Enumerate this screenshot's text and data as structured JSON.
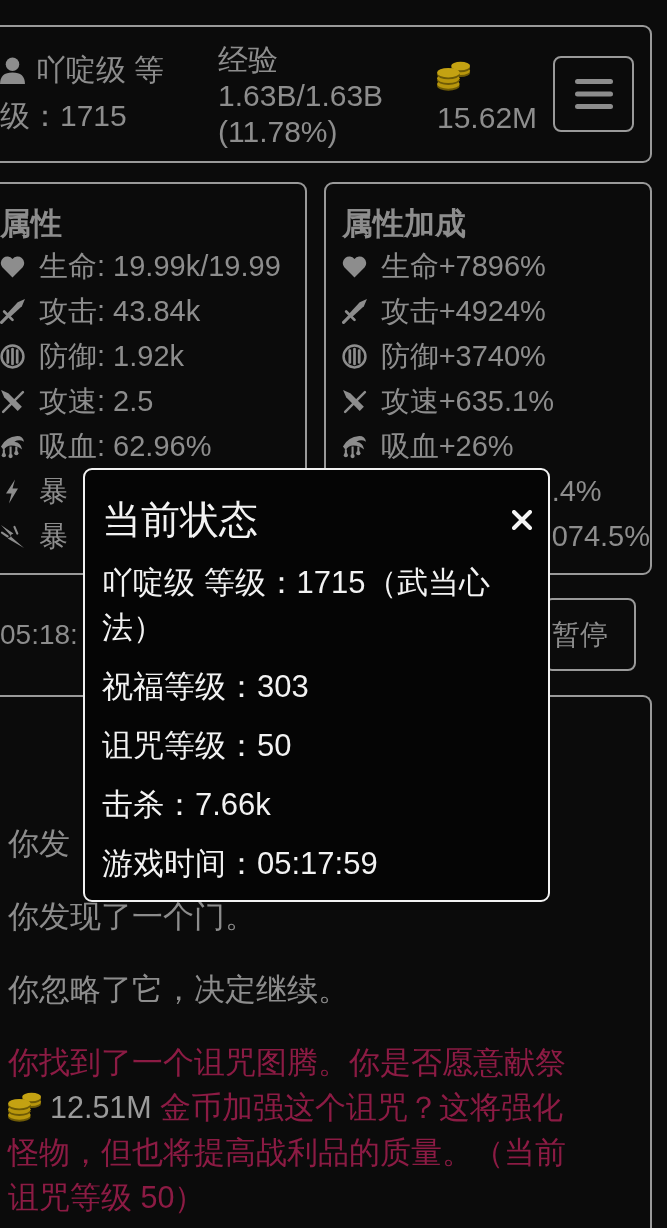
{
  "header": {
    "player": {
      "lines": [
        "吖啶级 等",
        "级：1715"
      ]
    },
    "experience": {
      "label": "经验",
      "value": "1.63B/1.63B",
      "percent": "(11.78%)"
    },
    "gold": "15.62M"
  },
  "panels": [
    {
      "title": "属性",
      "rows": [
        {
          "kind": "life",
          "text": "生命: 19.99k/19.99"
        },
        {
          "kind": "attack",
          "text": "攻击: 43.84k"
        },
        {
          "kind": "defense",
          "text": "防御: 1.92k"
        },
        {
          "kind": "speed",
          "text": "攻速: 2.5"
        },
        {
          "kind": "drain",
          "text": "吸血: 62.96%"
        },
        {
          "kind": "critrate",
          "text": "暴"
        },
        {
          "kind": "critdamage",
          "text": "暴"
        }
      ]
    },
    {
      "title": "属性加成",
      "rows": [
        {
          "kind": "life",
          "text": "生命+7896%"
        },
        {
          "kind": "attack",
          "text": "攻击+4924%"
        },
        {
          "kind": "defense",
          "text": "防御+3740%"
        },
        {
          "kind": "speed",
          "text": "攻速+635.1%"
        },
        {
          "kind": "drain",
          "text": "吸血+26%"
        },
        {
          "kind": "tail",
          "text": ".4%"
        },
        {
          "kind": "tail",
          "text": "074.5%"
        }
      ]
    }
  ],
  "timer": {
    "clock": "05:18:",
    "pause_button": "暂停"
  },
  "log": [
    {
      "kind": "plain",
      "text": "你发"
    },
    {
      "kind": "plain",
      "text": "你发现了一个门。"
    },
    {
      "kind": "plain",
      "text": "你忽略了它，决定继续。"
    },
    {
      "kind": "event",
      "segments": [
        {
          "kind": "text",
          "text": "你找到了一个诅咒图腾。你是否愿意献祭"
        },
        {
          "kind": "coin"
        },
        {
          "kind": "amount",
          "text": "12.51M"
        },
        {
          "kind": "text",
          "text": "金币加强这个诅咒？这将强化怪物，但也将提高战利品的质量。（当前诅咒等级 50）"
        }
      ]
    }
  ],
  "dialog": {
    "title": "当前状态",
    "lines": [
      "吖啶级 等级：1715（武当心法）",
      "祝福等级：303",
      "诅咒等级：50",
      "击杀：7.66k",
      "游戏时间：05:17:59"
    ]
  }
}
